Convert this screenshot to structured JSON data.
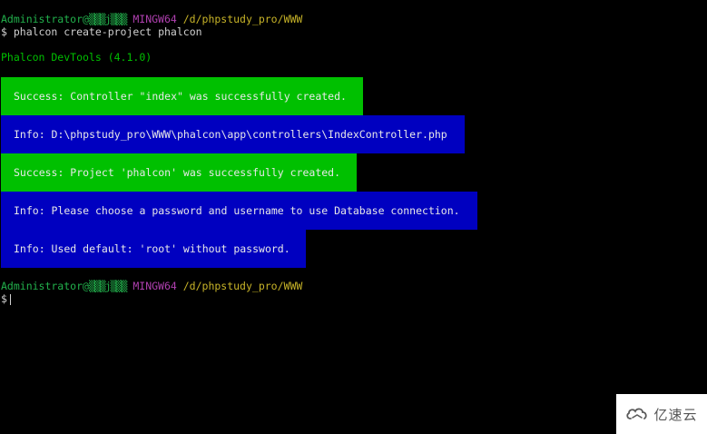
{
  "prompt1": {
    "user": "Administrator@",
    "host": "▒▒▒j▒▒▒",
    "shell": "MINGW64",
    "path": "/d/phpstudy_pro/WWW"
  },
  "command": "$ phalcon create-project phalcon",
  "tool_version": "Phalcon DevTools (4.1.0)",
  "messages": [
    {
      "type": "success",
      "text": "Success: Controller \"index\" was successfully created."
    },
    {
      "type": "info",
      "text": "Info: D:\\phpstudy_pro\\WWW\\phalcon\\app\\controllers\\IndexController.php"
    },
    {
      "type": "success",
      "text": "Success: Project 'phalcon' was successfully created."
    },
    {
      "type": "info",
      "text": "Info: Please choose a password and username to use Database connection."
    },
    {
      "type": "info",
      "text": "Info: Used default: 'root' without password."
    }
  ],
  "prompt2": {
    "user": "Administrator@",
    "host": "▒▒▒j▒▒▒",
    "shell": "MINGW64",
    "path": "/d/phpstudy_pro/WWW"
  },
  "input_prompt": "$",
  "watermark": {
    "text": "亿速云",
    "icon": "cloud-logo-icon"
  },
  "colors": {
    "success_bg": "#00c000",
    "info_bg": "#0000c0",
    "user": "#22b14c",
    "shell": "#b040b0",
    "path": "#c8b428"
  }
}
